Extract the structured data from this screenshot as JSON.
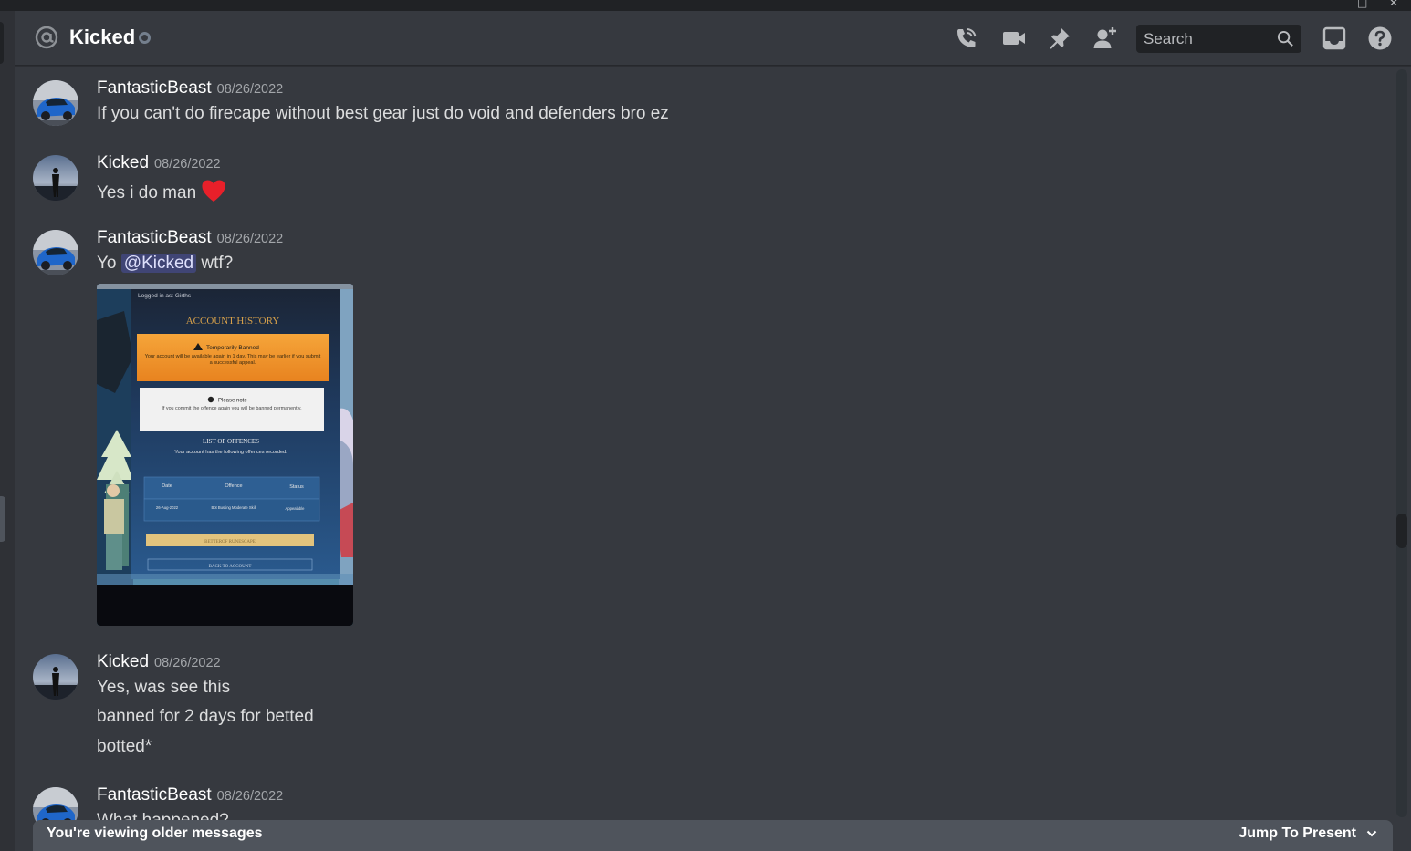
{
  "window": {
    "restore_glyph": "□",
    "close_glyph": "✕"
  },
  "header": {
    "channel_name": "Kicked",
    "channel_icon": "at-sign-icon",
    "status": "offline",
    "search_placeholder": "Search",
    "icons": [
      "voice-call-icon",
      "video-call-icon",
      "pinned-messages-icon",
      "add-friend-icon",
      "inbox-icon",
      "help-icon"
    ]
  },
  "messages": [
    {
      "author": "FantasticBeast",
      "timestamp": "08/26/2022",
      "lines": [
        "If you can't do firecape without best gear just do void and defenders bro ez"
      ]
    },
    {
      "author": "Kicked",
      "timestamp": "08/26/2022",
      "lines": [
        "Yes i do man"
      ],
      "emoji": "heart-icon"
    },
    {
      "author": "FantasticBeast",
      "timestamp": "08/26/2022",
      "prefix": "Yo",
      "mention": "@Kicked",
      "suffix": "wtf?",
      "attachment": {
        "logged_in": "Logged in as: Girths",
        "title": "ACCOUNT HISTORY",
        "ban_title": "Temporarily Banned",
        "ban_text": "Your account will be available again in 1 day. This may be earlier if you submit a successful appeal.",
        "note_title": "Please note",
        "note_text": "If you commit the offence again you will be banned permanently.",
        "offences_title": "LIST OF OFFENCES",
        "offences_sub": "Your account has the following offences recorded.",
        "table_headers": [
          "Date",
          "Offence",
          "Status"
        ],
        "table_row": [
          "26-Aug-2022",
          "Bot Busting Moderate Skill",
          "Appealable"
        ],
        "button_primary": "BETTEROF RUNESCAPE",
        "button_secondary": "BACK TO ACCOUNT"
      }
    },
    {
      "author": "Kicked",
      "timestamp": "08/26/2022",
      "lines": [
        "Yes, was see this",
        "banned for 2 days for betted",
        "botted*"
      ]
    },
    {
      "author": "FantasticBeast",
      "timestamp": "08/26/2022",
      "lines": [
        "What happened?"
      ]
    }
  ],
  "older_bar": {
    "text": "You're viewing older messages",
    "jump_label": "Jump To Present"
  },
  "colors": {
    "background": "#36393f",
    "header_bg": "#36393f",
    "search_bg": "#202225",
    "mention_bg": "#3c4270",
    "heart": "#e8202a",
    "older_bar_bg": "#4f545c"
  }
}
